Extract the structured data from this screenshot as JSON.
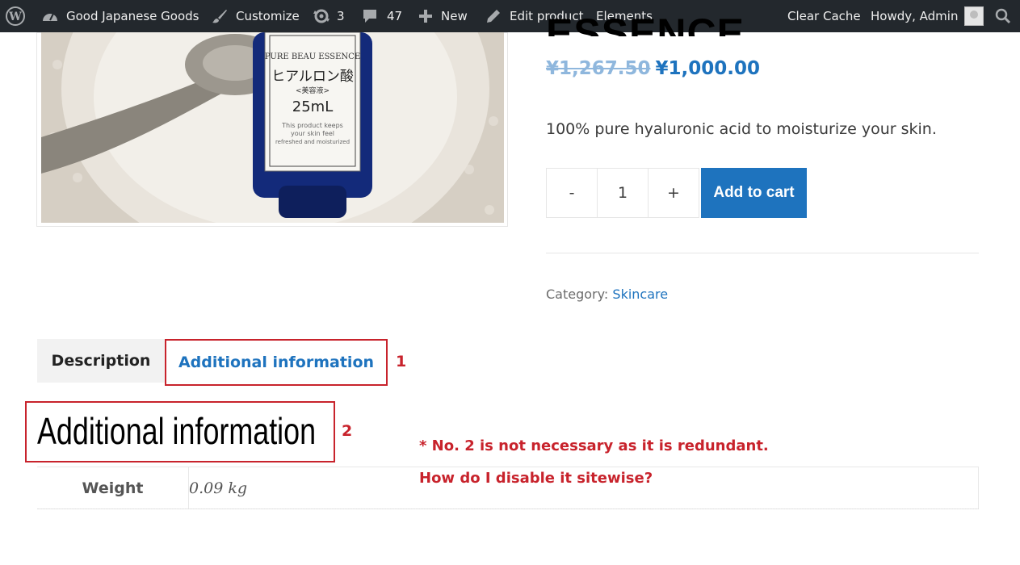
{
  "adminbar": {
    "site_name": "Good Japanese Goods",
    "customize": "Customize",
    "updates_count": "3",
    "comments_count": "47",
    "new_label": "New",
    "edit_product": "Edit product",
    "elements": "Elements",
    "clear_cache": "Clear Cache",
    "howdy": "Howdy, Admin"
  },
  "product": {
    "title_fragment": "ESSENCE",
    "price_old": "¥1,267.50",
    "price_new": "¥1,000.00",
    "short_description": "100% pure hyaluronic acid to moisturize your skin.",
    "image_label": {
      "line1": "PURE BEAU ESSENCE",
      "line2": "ヒアルロン酸",
      "line3": "<美容液>",
      "line4": "25mL",
      "line5": "This product keeps",
      "line6": "your skin feel",
      "line7": "refreshed and moisturized"
    }
  },
  "cart": {
    "minus": "-",
    "quantity": "1",
    "plus": "+",
    "add_to_cart": "Add to cart"
  },
  "meta": {
    "category_label": "Category:",
    "category_value": "Skincare"
  },
  "tabs": [
    {
      "label": "Description"
    },
    {
      "label": "Additional information"
    }
  ],
  "annotations": {
    "mark1": "1",
    "mark2": "2",
    "note_line1": "* No. 2 is not necessary as it is redundant.",
    "note_line2": "How do I disable it sitewise?"
  },
  "additional_info": {
    "heading": "Additional information",
    "rows": [
      {
        "label": "Weight",
        "value": "0.09 kg"
      }
    ]
  },
  "colors": {
    "adminbar_bg": "#23282d",
    "accent": "#1e73be",
    "annotation_red": "#c8232c"
  }
}
